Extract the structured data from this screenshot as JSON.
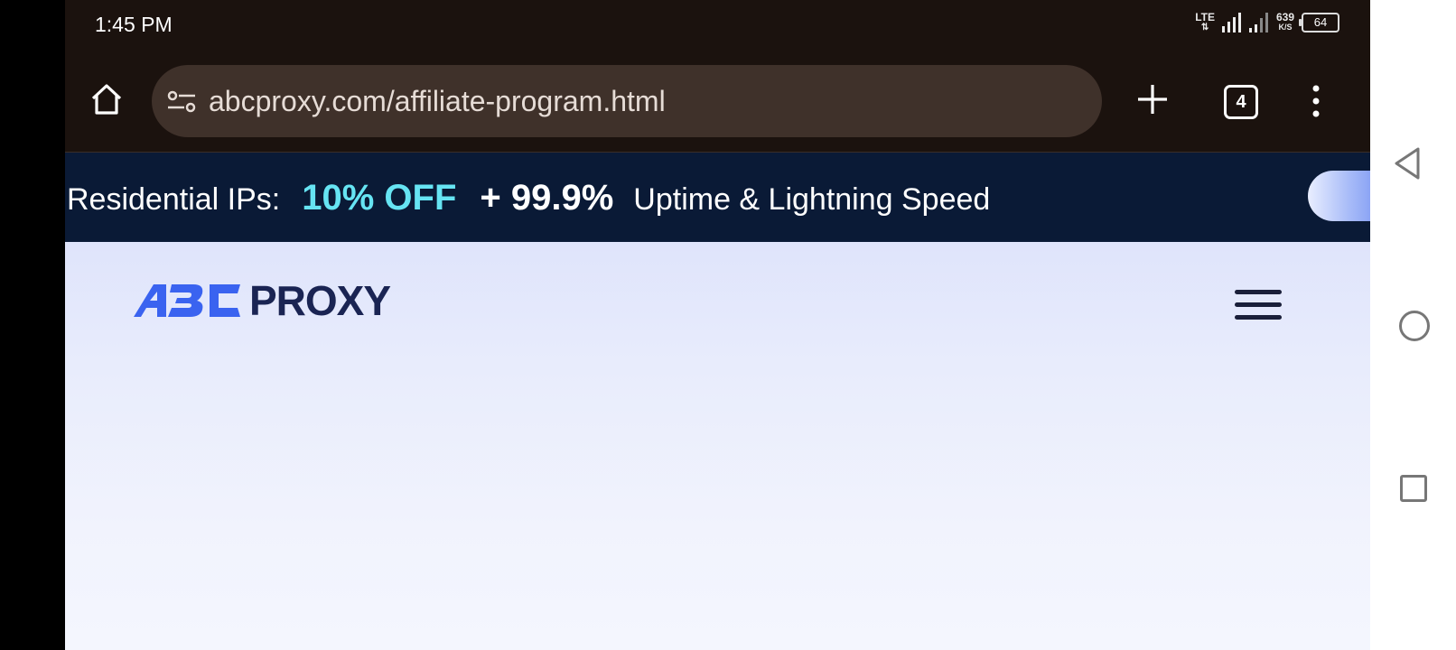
{
  "status_bar": {
    "time": "1:45 PM",
    "network": "LTE",
    "net_speed_value": "639",
    "net_speed_unit": "K/S",
    "battery": "64"
  },
  "browser": {
    "url": "abcproxy.com/affiliate-program.html",
    "tab_count": "4"
  },
  "promo": {
    "label": "Residential IPs:",
    "discount": "10% OFF",
    "uptime": "+ 99.9%",
    "tagline": "Uptime & Lightning Speed"
  },
  "header": {
    "logo_text": "ABC PROXY",
    "logo_word": "PROXY"
  },
  "colors": {
    "browser_bg": "#1b120e",
    "urlbar_bg": "#3f312a",
    "promo_bg": "#0a1a36",
    "promo_accent": "#66e4f3",
    "logo_blue": "#3a63f0",
    "logo_navy": "#1a2453"
  },
  "icons": [
    "home-icon",
    "site-settings-icon",
    "plus-icon",
    "tabs-icon",
    "more-vert-icon",
    "menu-icon",
    "back-icon",
    "circle-home-icon",
    "recent-apps-icon"
  ]
}
